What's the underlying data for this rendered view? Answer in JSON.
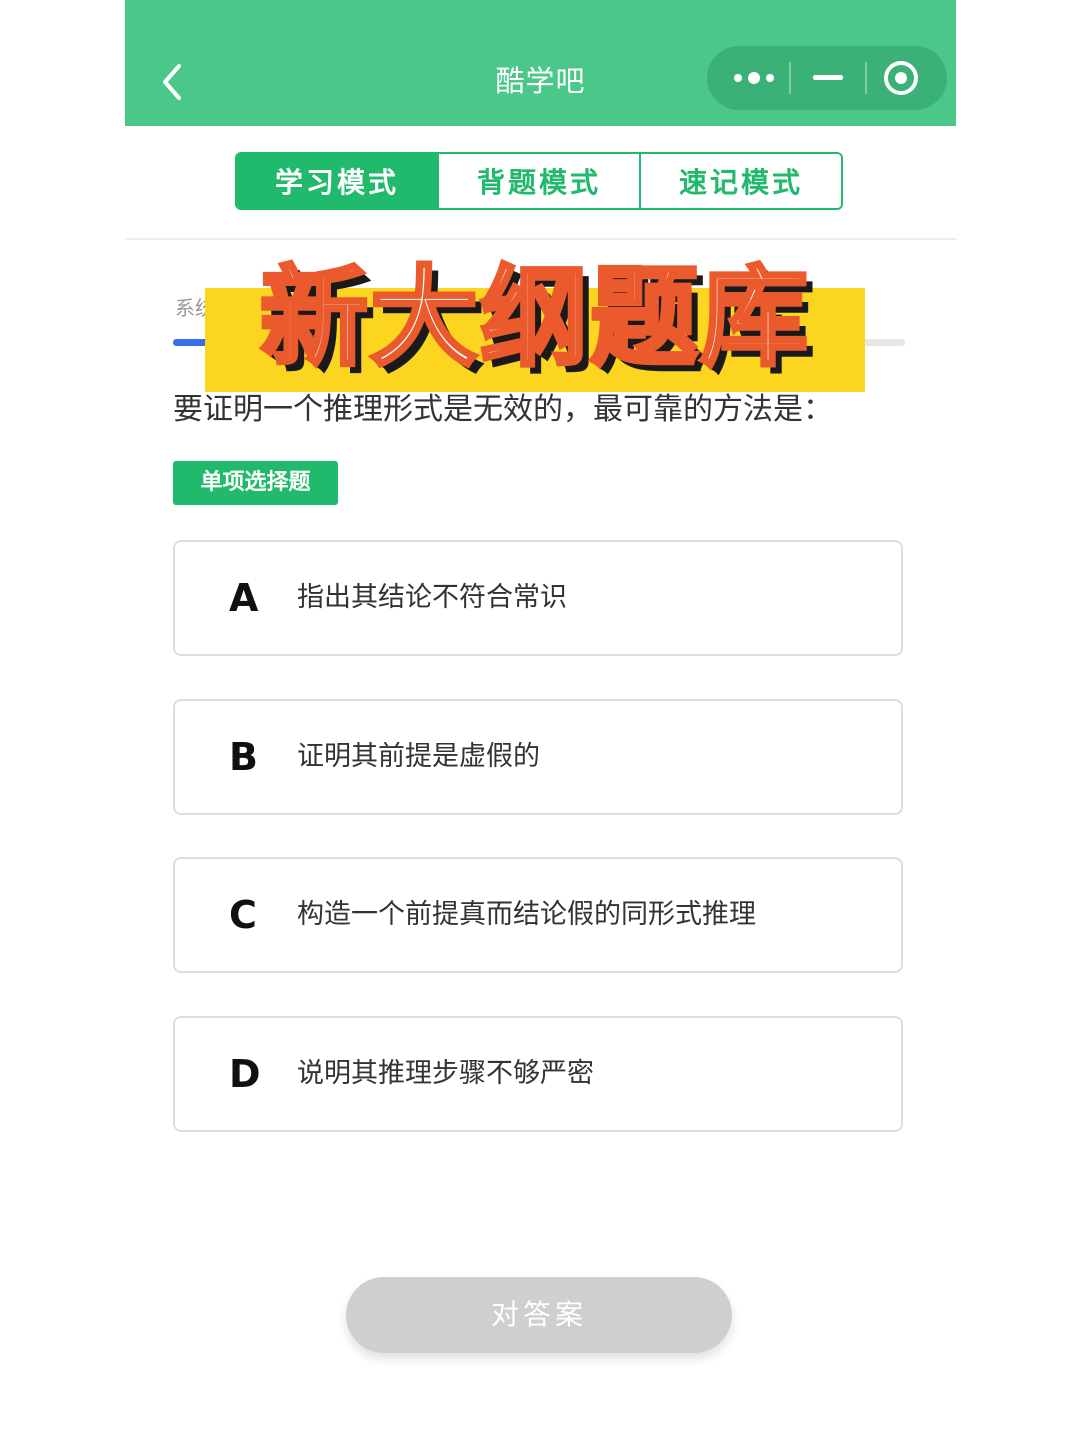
{
  "header": {
    "title": "酷学吧",
    "back_icon": "chevron-left-icon",
    "more_icon": "more-dots-icon",
    "minimize_icon": "minimize-icon",
    "close_icon": "target-close-icon",
    "color": "#4bc78a"
  },
  "tabs": [
    {
      "label": "学习模式",
      "active": true
    },
    {
      "label": "背题模式",
      "active": false
    },
    {
      "label": "速记模式",
      "active": false
    }
  ],
  "progress": {
    "category_label": "系统",
    "fraction": 0.05
  },
  "banner": {
    "text": "新大纲题库"
  },
  "question": {
    "text": "要证明一个推理形式是无效的，最可靠的方法是：",
    "type_label": "单项选择题"
  },
  "options": [
    {
      "letter": "A",
      "text": "指出其结论不符合常识"
    },
    {
      "letter": "B",
      "text": "证明其前提是虚假的"
    },
    {
      "letter": "C",
      "text": "构造一个前提真而结论假的同形式推理"
    },
    {
      "letter": "D",
      "text": "说明其推理步骤不够严密"
    }
  ],
  "submit": {
    "label": "对答案"
  },
  "colors": {
    "accent": "#21b96b",
    "progress": "#3a6ee8",
    "banner_bg": "#fbd51f",
    "banner_stroke": "#ea5a2c"
  }
}
